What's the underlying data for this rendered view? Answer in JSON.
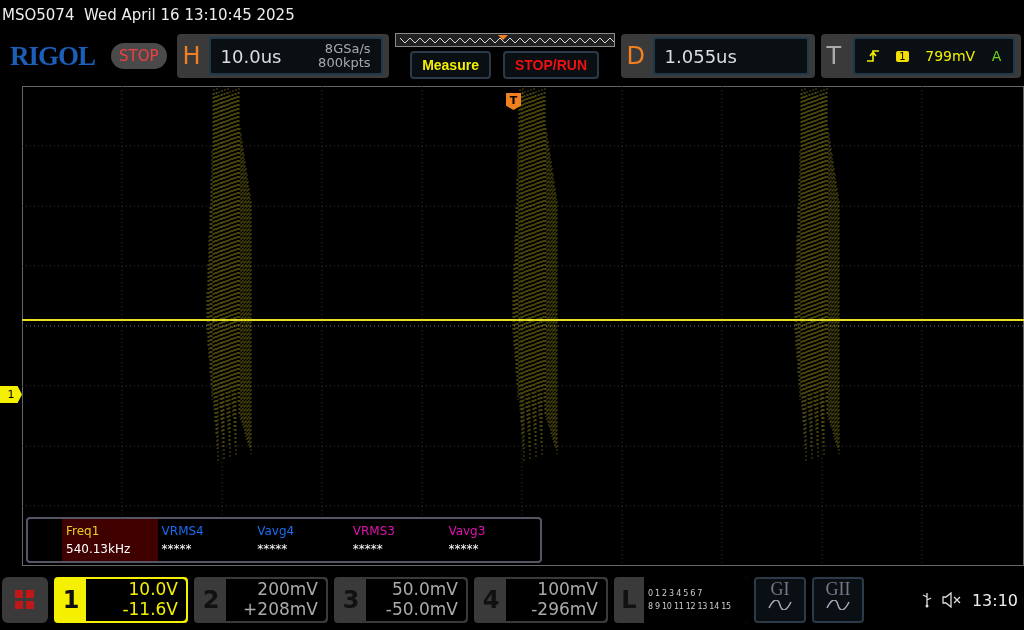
{
  "status_line": {
    "model": "MSO5074",
    "datetime": "Wed April 16 13:10:45 2025"
  },
  "header": {
    "logo": "RIGOL",
    "run_state": "STOP",
    "horizontal": {
      "label": "H",
      "timebase": "10.0us",
      "sample_rate": "8GSa/s",
      "memory": "800kpts"
    },
    "buttons": [
      {
        "label": "Measure",
        "kind": "menu"
      },
      {
        "label": "STOP/RUN",
        "kind": "run"
      }
    ],
    "delay": {
      "label": "D",
      "value": "1.055us"
    },
    "trigger": {
      "label": "T",
      "source": "1",
      "level": "799mV",
      "mode": "A"
    }
  },
  "markers": {
    "trigger": "T",
    "channel": "1"
  },
  "measurements": [
    {
      "name": "Freq1",
      "value": "540.13kHz",
      "color": "#e8d020",
      "selected": true
    },
    {
      "name": "VRMS4",
      "value": "*****",
      "color": "#1a6cf0",
      "selected": false
    },
    {
      "name": "Vavg4",
      "value": "*****",
      "color": "#1a6cf0",
      "selected": false
    },
    {
      "name": "VRMS3",
      "value": "*****",
      "color": "#e010b0",
      "selected": false
    },
    {
      "name": "Vavg3",
      "value": "*****",
      "color": "#e010b0",
      "selected": false
    }
  ],
  "channels": [
    {
      "number": "1",
      "scale": "10.0V",
      "offset": "-11.6V",
      "selected": true
    },
    {
      "number": "2",
      "scale": "200mV",
      "offset": "+208mV",
      "selected": false
    },
    {
      "number": "3",
      "scale": "50.0mV",
      "offset": "-50.0mV",
      "selected": false
    },
    {
      "number": "4",
      "scale": "100mV",
      "offset": "-296mV",
      "selected": false
    }
  ],
  "logic": {
    "label": "L",
    "rows": [
      "0 1 2 3 4 5 6 7",
      "8 9 10 11 12 13 14 15"
    ]
  },
  "generators": [
    "GI",
    "GII"
  ],
  "tray": {
    "time": "13:10"
  }
}
